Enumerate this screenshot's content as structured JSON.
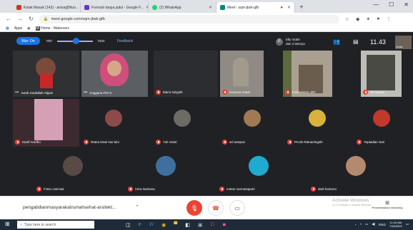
{
  "browser": {
    "tabs": [
      {
        "title": "Kotak Masuk (143) - anisa@fitun...",
        "color": "#d93025",
        "active": false
      },
      {
        "title": "Formulir tanpa judul - Google F...",
        "color": "#673ab7",
        "active": false
      },
      {
        "title": "(2) WhatsApp",
        "color": "#25d366",
        "active": false
      },
      {
        "title": "Meet - sqm-jbsk-gfb",
        "color": "#00897b",
        "active": true
      }
    ],
    "url": "meet.google.com/sqm-jbsk-gfb",
    "bookmarks": [
      {
        "label": "Apps"
      },
      {
        "label": "Home - Mateonex"
      }
    ]
  },
  "meet": {
    "blur_label": "Blur: On",
    "slider_min": "min",
    "slider_max": "max",
    "feedback_label": "Feedback",
    "organizer_initial": "E",
    "organizer_line1": "Elly Indah",
    "organizer_line2": "dan 3 lainnya",
    "time": "11.43",
    "self_name": "Anda",
    "participants": [
      {
        "name": "Jundi Jundullah Afgani"
      },
      {
        "name": "Anggana Fitri S"
      },
      {
        "name": "Mario Ningsih"
      },
      {
        "name": "Kusuma Astuti"
      },
      {
        "name": "Kuswantoro 157"
      },
      {
        "name": "Sri Utomo"
      },
      {
        "name": "Hanif Amdho"
      },
      {
        "name": "Ratna Dewi Nur'aini"
      },
      {
        "name": "Yuli Astuti"
      },
      {
        "name": "ari weepoe"
      },
      {
        "name": "PAUD Ratnaningsih"
      },
      {
        "name": "Yeptadian Sari"
      },
      {
        "name": "Finta Lissinsia"
      },
      {
        "name": "Citra Nutriana"
      },
      {
        "name": "melan nurmasaputri"
      },
      {
        "name": "dedi hantono"
      }
    ],
    "meeting_name": "pengabdianmasyarakatrumahsehat-arsitekt...",
    "activate_title": "Activate Windows",
    "activate_sub": "Go to Settings to activate Windows.",
    "present_label": "Presentasikan sekarang"
  },
  "taskbar": {
    "search_placeholder": "Type here to search",
    "lang": "ENG",
    "time": "11:43 AM",
    "date": "7/18/2020"
  },
  "colors": {
    "accent": "#1a73e8",
    "end_call": "#ea4335",
    "meet_bg": "#202124"
  }
}
